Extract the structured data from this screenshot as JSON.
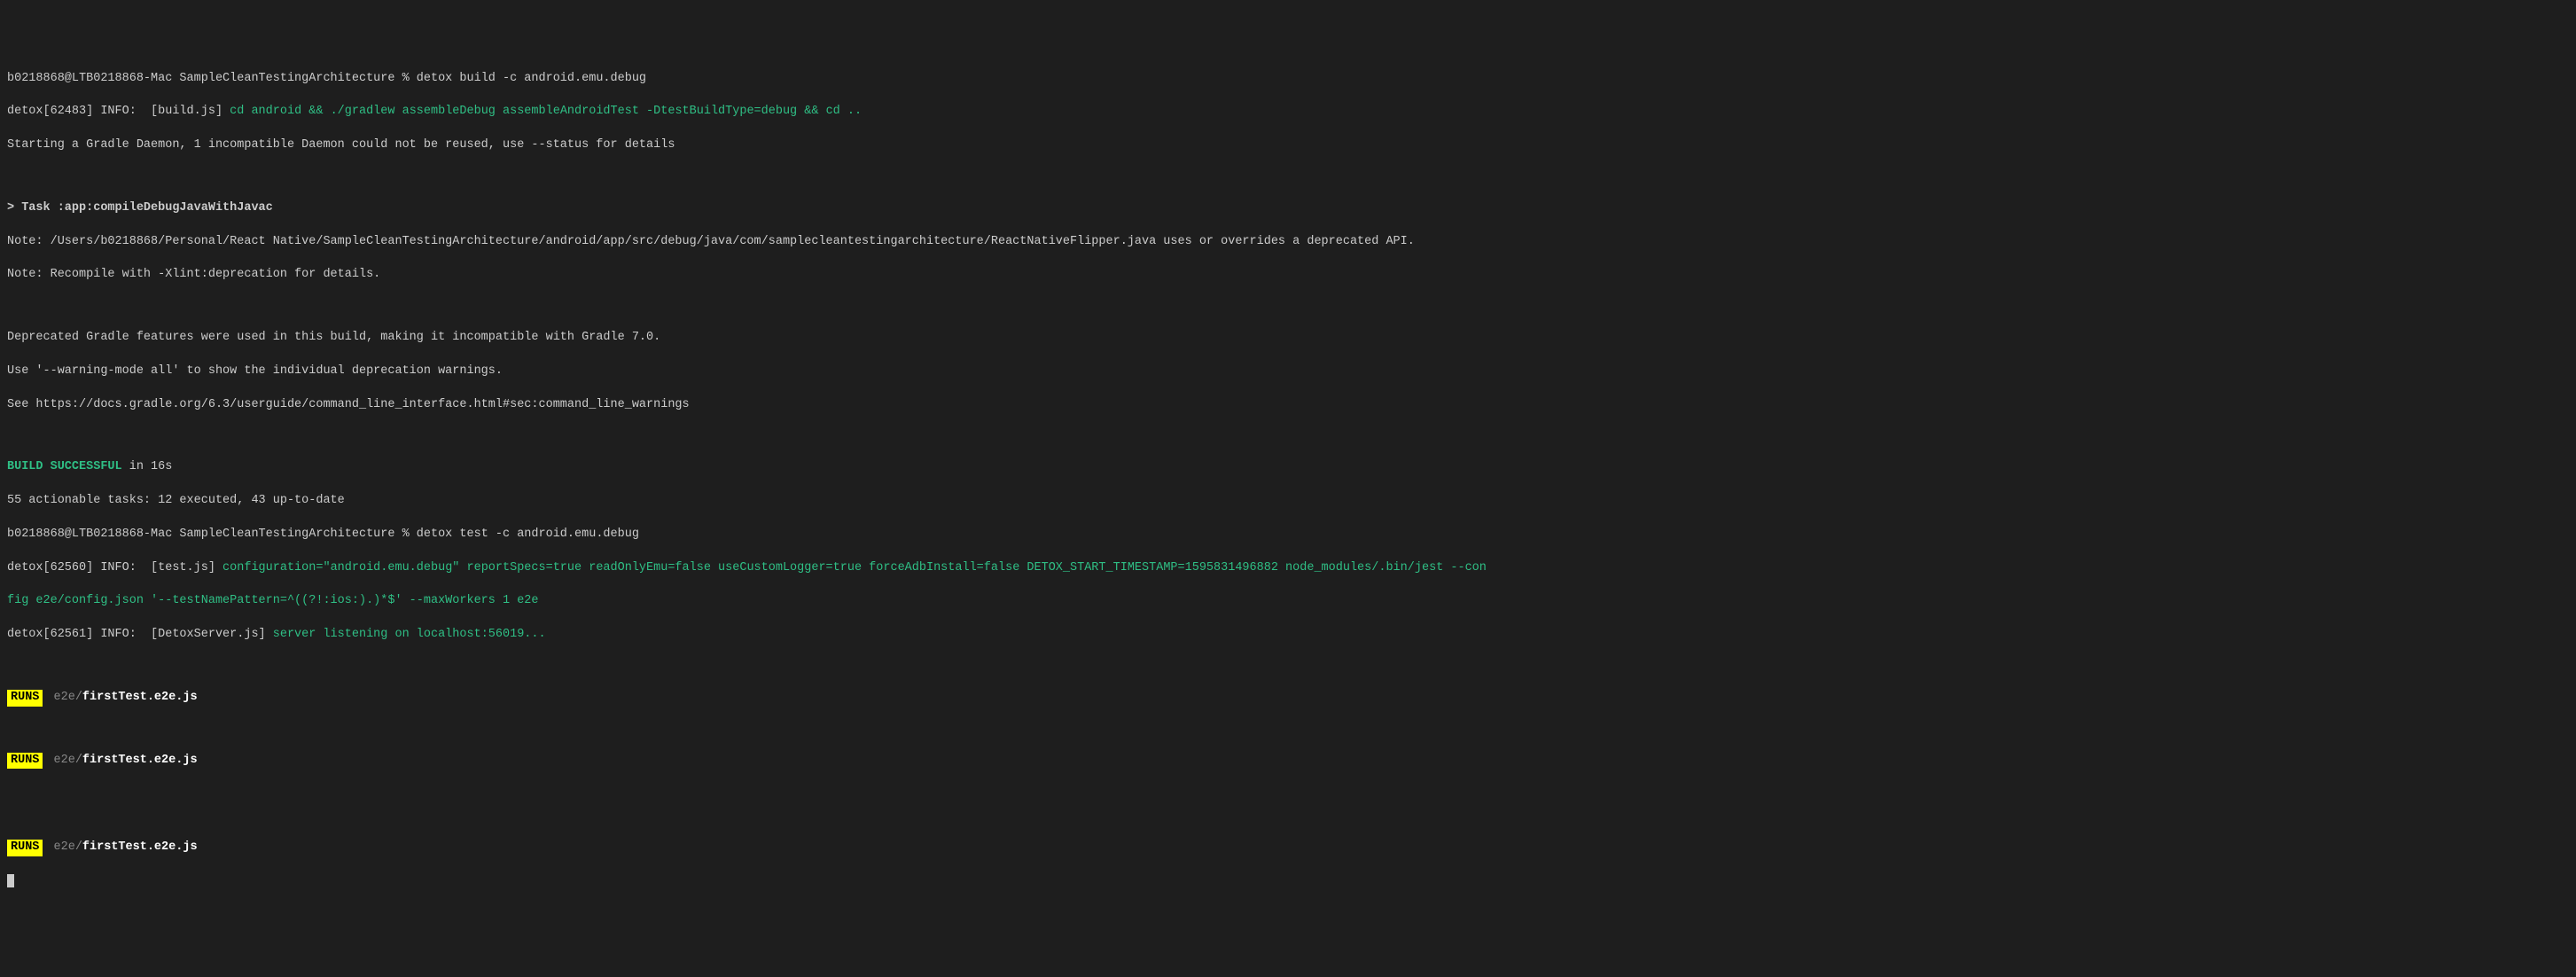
{
  "prompt1": {
    "prefix": "b0218868@LTB0218868-Mac SampleCleanTestingArchitecture % ",
    "cmd": "detox build -c android.emu.debug"
  },
  "line2": {
    "prefix": "detox[62483] INFO:  [build.js] ",
    "cmd": "cd android && ./gradlew assembleDebug assembleAndroidTest -DtestBuildType=debug && cd .."
  },
  "line3": "Starting a Gradle Daemon, 1 incompatible Daemon could not be reused, use --status for details",
  "task": "> Task :app:compileDebugJavaWithJavac",
  "note1": "Note: /Users/b0218868/Personal/React Native/SampleCleanTestingArchitecture/android/app/src/debug/java/com/samplecleantestingarchitecture/ReactNativeFlipper.java uses or overrides a deprecated API.",
  "note2": "Note: Recompile with -Xlint:deprecation for details.",
  "dep1": "Deprecated Gradle features were used in this build, making it incompatible with Gradle 7.0.",
  "dep2": "Use '--warning-mode all' to show the individual deprecation warnings.",
  "dep3": "See https://docs.gradle.org/6.3/userguide/command_line_interface.html#sec:command_line_warnings",
  "build_success": "BUILD SUCCESSFUL",
  "build_time": " in 16s",
  "tasks": "55 actionable tasks: 12 executed, 43 up-to-date",
  "prompt2": {
    "prefix": "b0218868@LTB0218868-Mac SampleCleanTestingArchitecture % ",
    "cmd": "detox test -c android.emu.debug"
  },
  "testinfo": {
    "prefix": "detox[62560] INFO:  [test.js] ",
    "cmd1": "configuration=\"android.emu.debug\" reportSpecs=true readOnlyEmu=false useCustomLogger=true forceAdbInstall=false DETOX_START_TIMESTAMP=1595831496882 node_modules/.bin/jest --con",
    "cmd2": "fig e2e/config.json '--testNamePattern=^((?!:ios:).)*$' --maxWorkers 1 e2e"
  },
  "serverinfo": {
    "prefix": "detox[62561] INFO:  [DetoxServer.js] ",
    "msg": "server listening on localhost:56019..."
  },
  "runs": {
    "badge": "RUNS",
    "dir": "e2e/",
    "file": "firstTest.e2e.js"
  }
}
